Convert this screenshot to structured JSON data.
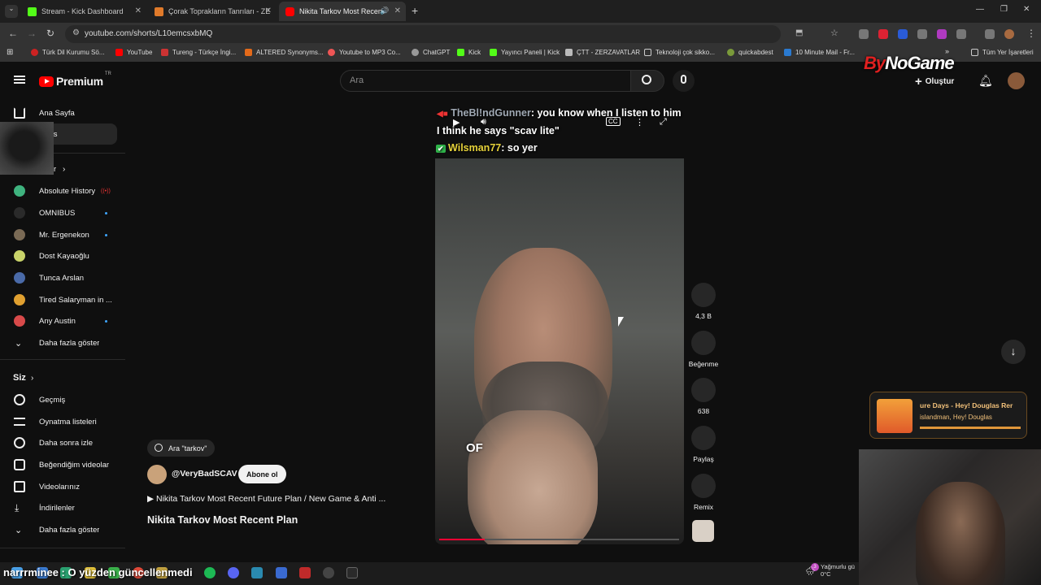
{
  "browser": {
    "tabs": [
      {
        "title": "Stream - Kick Dashboard",
        "active": false
      },
      {
        "title": "Çorak Toprakların Tanrıları - ZE",
        "active": false
      },
      {
        "title": "Nikita Tarkov Most Recent",
        "active": true
      }
    ],
    "url": "youtube.com/shorts/L10emcsxbMQ",
    "bookmarks": [
      "Türk Dil Kurumu Sö...",
      "YouTube",
      "Tureng - Türkçe İngi...",
      "ALTERED Synonyms...",
      "Youtube to MP3 Co...",
      "ChatGPT",
      "Kick",
      "Yayıncı Paneli | Kick",
      "ÇTT - ZERZAVATLAR",
      "Teknoloji çok sikko...",
      "quickabdest",
      "10 Minute Mail - Fr...",
      "Tüm Yer İşaretleri"
    ]
  },
  "header": {
    "logo": "Premium",
    "region": "TR",
    "search_placeholder": "Ara",
    "create_label": "Oluştur",
    "overlay_logo_a": "By",
    "overlay_logo_b": "NoGame"
  },
  "sidebar": {
    "top_items": [
      {
        "label": "Ana Sayfa",
        "icon": "home-icon"
      },
      {
        "label": "rts",
        "icon": "shorts-icon"
      }
    ],
    "subs_header": "r",
    "subscriptions": [
      {
        "label": "Absolute History",
        "indicator": "live",
        "color": "#3fb37f"
      },
      {
        "label": "OMNIBUS",
        "indicator": "dot",
        "color": "#2a2a2a"
      },
      {
        "label": "Mr. Ergenekon",
        "indicator": "dot",
        "color": "#7a6a55"
      },
      {
        "label": "Dost Kayaoğlu",
        "indicator": "none",
        "color": "#c9d36a"
      },
      {
        "label": "Tunca Arslan",
        "indicator": "none",
        "color": "#4a6aa8"
      },
      {
        "label": "Tired Salaryman in ...",
        "indicator": "none",
        "color": "#e0a030"
      },
      {
        "label": "Any Austin",
        "indicator": "dot",
        "color": "#d84a4a"
      }
    ],
    "show_more_1": "Daha fazla göster",
    "you_header": "Siz",
    "you_items": [
      {
        "label": "Geçmiş",
        "icon": "history-icon"
      },
      {
        "label": "Oynatma listeleri",
        "icon": "playlists-icon"
      },
      {
        "label": "Daha sonra izle",
        "icon": "watch-later-icon"
      },
      {
        "label": "Beğendiğim videolar",
        "icon": "liked-icon"
      },
      {
        "label": "Videolarınız",
        "icon": "your-videos-icon"
      },
      {
        "label": "İndirilenler",
        "icon": "downloads-icon"
      }
    ],
    "show_more_2": "Daha fazla göster"
  },
  "video": {
    "caption": "OF",
    "progress_fraction": 0.19
  },
  "stream_chat": [
    {
      "user": "TheBl!ndGunner",
      "message": ": you know when I listen to him I think he says \"scav lite\""
    },
    {
      "user": "Wilsman77",
      "message": ": so yer"
    }
  ],
  "bottom_chat": "narrrminee : O yüzden güncellenmedi",
  "actions": {
    "like_count": "4,3 B",
    "dislike_label": "Beğenme",
    "comment_count": "638",
    "share_label": "Paylaş",
    "remix_label": "Remix"
  },
  "info": {
    "search_chip": "Ara \"tarkov\"",
    "channel": "@VeryBadSCAV",
    "subscribe_label": "Abone ol",
    "playlist": "▶ Nikita Tarkov Most Recent Future Plan / New Game & Anti ...",
    "title": "Nikita Tarkov Most Recent Plan"
  },
  "music_widget": {
    "track": "ure Days - Hey! Douglas Rer",
    "artist": "islandman, Hey! Douglas",
    "progress_fraction": 1.0
  },
  "taskbar": {
    "weather": "Yağmurlu gü",
    "temp": "0°C",
    "notification_count": "3"
  }
}
